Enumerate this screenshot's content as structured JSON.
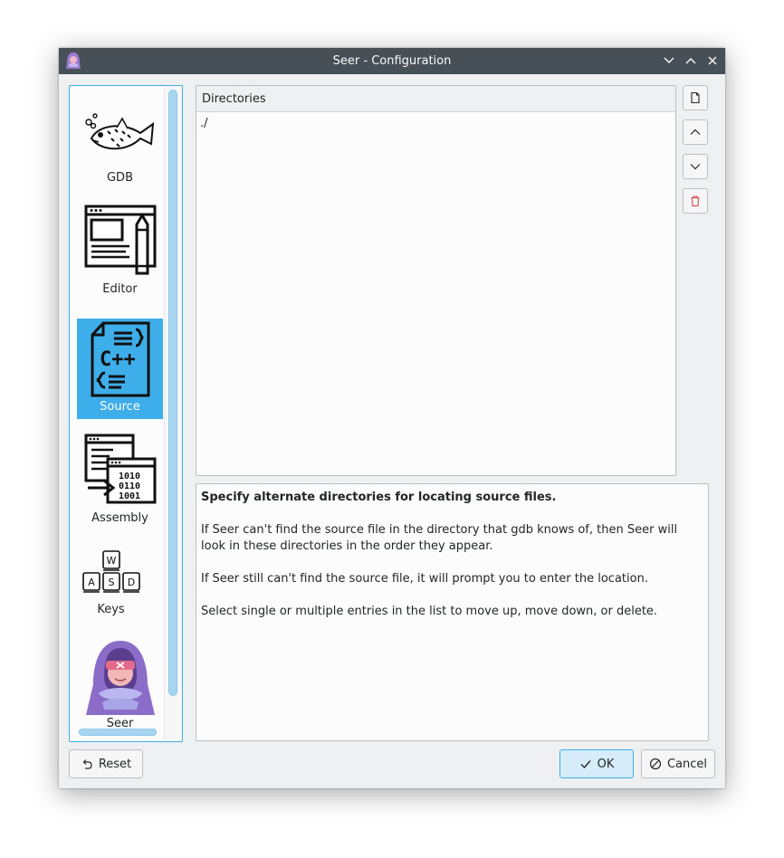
{
  "window": {
    "title": "Seer - Configuration"
  },
  "sidebar": {
    "items": [
      {
        "label": "GDB",
        "icon": "gdb-fish-icon"
      },
      {
        "label": "Editor",
        "icon": "editor-icon"
      },
      {
        "label": "Source",
        "icon": "cpp-source-icon",
        "selected": true
      },
      {
        "label": "Assembly",
        "icon": "assembly-icon"
      },
      {
        "label": "Keys",
        "icon": "wasd-keys-icon",
        "keys": [
          "W",
          "A",
          "S",
          "D"
        ]
      },
      {
        "label": "Seer",
        "icon": "seer-hooded-icon"
      }
    ]
  },
  "directories": {
    "header": "Directories",
    "entries": [
      "./"
    ]
  },
  "list_buttons": [
    "new-entry-icon",
    "move-up-icon",
    "move-down-icon",
    "delete-icon"
  ],
  "help": {
    "heading": "Specify alternate directories for locating source files.",
    "para1": "If Seer can't find the source file in the directory that gdb knows of, then Seer will look in these directories in the order they appear.",
    "para2": "If Seer still can't find the source file, it will prompt you to enter the location.",
    "para3": "Select single or multiple entries in the list to move up, move down, or delete."
  },
  "buttons": {
    "reset": "Reset",
    "ok": "OK",
    "cancel": "Cancel"
  },
  "colors": {
    "accent": "#3daee9",
    "titlebar": "#475057",
    "delete": "#da4453"
  }
}
